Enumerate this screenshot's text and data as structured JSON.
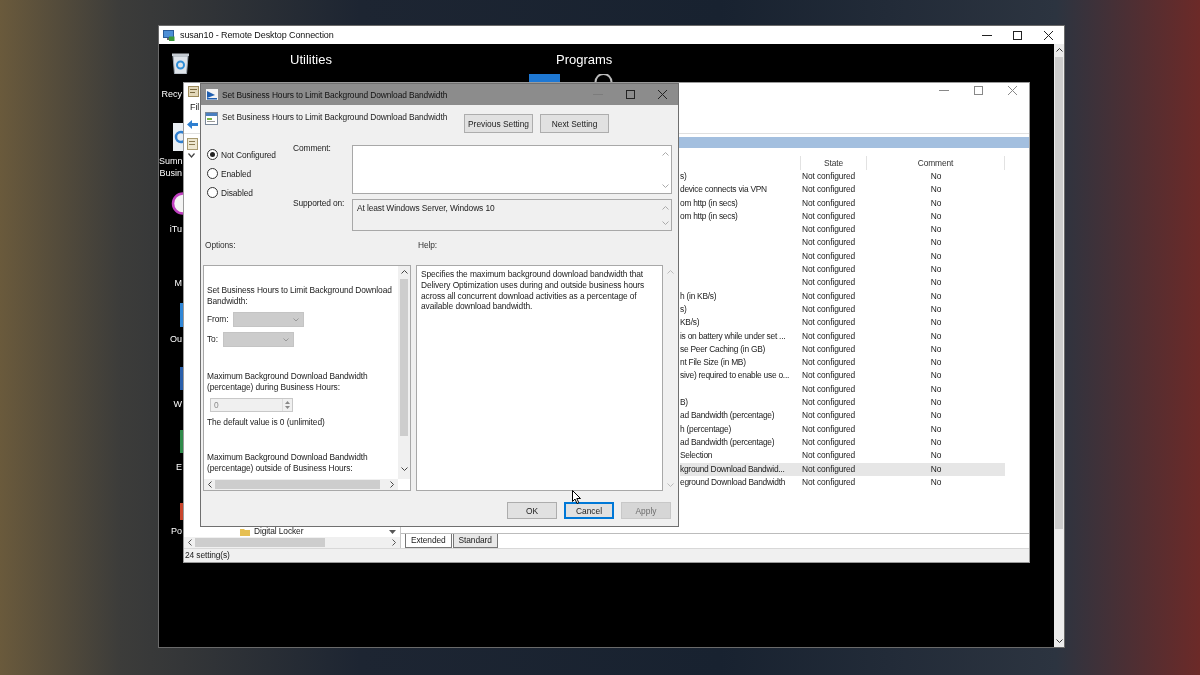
{
  "rdp_window": {
    "title": "susan10 - Remote Desktop Connection"
  },
  "remote_desktop": {
    "headings": [
      "Utilities",
      "Programs"
    ],
    "icons": [
      {
        "label": "Recy"
      },
      {
        "label": "Sumn Busin"
      },
      {
        "label": "iTu"
      },
      {
        "label": "M"
      },
      {
        "label": "Ou"
      },
      {
        "label": "W"
      },
      {
        "label": "E"
      },
      {
        "label": "Po"
      }
    ]
  },
  "policy_editor": {
    "menu": [
      "Fil"
    ],
    "columns": [
      "State",
      "Comment"
    ],
    "rows": [
      {
        "setting": "s)",
        "state": "Not configured",
        "comment": "No",
        "selected": false
      },
      {
        "setting": "device connects via VPN",
        "state": "Not configured",
        "comment": "No",
        "selected": false
      },
      {
        "setting": "om http (in secs)",
        "state": "Not configured",
        "comment": "No",
        "selected": false
      },
      {
        "setting": "om http (in secs)",
        "state": "Not configured",
        "comment": "No",
        "selected": false
      },
      {
        "state": "Not configured",
        "comment": "No",
        "selected": false
      },
      {
        "state": "Not configured",
        "comment": "No",
        "selected": false
      },
      {
        "state": "Not configured",
        "comment": "No",
        "selected": false
      },
      {
        "state": "Not configured",
        "comment": "No",
        "selected": false
      },
      {
        "state": "Not configured",
        "comment": "No",
        "selected": false
      },
      {
        "setting": "h (in KB/s)",
        "state": "Not configured",
        "comment": "No",
        "selected": false
      },
      {
        "setting": "s)",
        "state": "Not configured",
        "comment": "No",
        "selected": false
      },
      {
        "setting": "KB/s)",
        "state": "Not configured",
        "comment": "No",
        "selected": false
      },
      {
        "setting": "is on battery while under set ...",
        "state": "Not configured",
        "comment": "No",
        "selected": false
      },
      {
        "setting": "se Peer Caching (in GB)",
        "state": "Not configured",
        "comment": "No",
        "selected": false
      },
      {
        "setting": "nt File Size (in MB)",
        "state": "Not configured",
        "comment": "No",
        "selected": false
      },
      {
        "setting": "sive) required to enable use o...",
        "state": "Not configured",
        "comment": "No",
        "selected": false
      },
      {
        "state": "Not configured",
        "comment": "No",
        "selected": false
      },
      {
        "setting": "B)",
        "state": "Not configured",
        "comment": "No",
        "selected": false
      },
      {
        "setting": "ad Bandwidth (percentage)",
        "state": "Not configured",
        "comment": "No",
        "selected": false
      },
      {
        "setting": "h (percentage)",
        "state": "Not configured",
        "comment": "No",
        "selected": false
      },
      {
        "setting": "ad Bandwidth (percentage)",
        "state": "Not configured",
        "comment": "No",
        "selected": false
      },
      {
        "setting": "Selection",
        "state": "Not configured",
        "comment": "No",
        "selected": false
      },
      {
        "setting": "kground Download Bandwid...",
        "state": "Not configured",
        "comment": "No",
        "selected": true
      },
      {
        "setting": "eground Download Bandwidth",
        "state": "Not configured",
        "comment": "No",
        "selected": false
      }
    ],
    "tree_items": [
      "Digital Locker"
    ],
    "tabs": [
      {
        "label": "Extended",
        "selected": true
      },
      {
        "label": "Standard",
        "selected": false
      }
    ],
    "status_bar": "24 setting(s)"
  },
  "dialog": {
    "title": "Set Business Hours to Limit Background Download Bandwidth",
    "setting": "Set Business Hours to Limit Background Download Bandwidth",
    "nav_buttons": [
      "Previous Setting",
      "Next Setting"
    ],
    "states": [
      {
        "label": "Not Configured",
        "selected": true
      },
      {
        "label": "Enabled",
        "selected": false
      },
      {
        "label": "Disabled",
        "selected": false
      }
    ],
    "comment_label": "Comment:",
    "supported_label": "Supported on:",
    "supported_on": "At least Windows Server, Windows 10",
    "options_label": "Options:",
    "help_label": "Help:",
    "options": [
      {
        "kind": "text",
        "text": "Set Business Hours to Limit Background Download Bandwidth:"
      },
      {
        "kind": "dropdown",
        "label": "From:",
        "disabled": true
      },
      {
        "kind": "dropdown",
        "label": "To:",
        "disabled": true
      },
      {
        "kind": "text",
        "text": "Maximum Background Download Bandwidth (percentage) during Business Hours:"
      },
      {
        "kind": "spinner",
        "value": "0",
        "disabled": true
      },
      {
        "kind": "text",
        "text": "The default value is 0 (unlimited)"
      },
      {
        "kind": "text",
        "text": "Maximum Background Download Bandwidth (percentage) outside of Business Hours:"
      }
    ],
    "help": "Specifies the maximum background download bandwidth that Delivery Optimization uses during and outside business hours across all concurrent download activities as a percentage of available download bandwidth.",
    "buttons": [
      {
        "label": "OK",
        "focused": false,
        "disabled": false
      },
      {
        "label": "Cancel",
        "focused": true,
        "disabled": false
      },
      {
        "label": "Apply",
        "focused": false,
        "disabled": true
      }
    ]
  }
}
